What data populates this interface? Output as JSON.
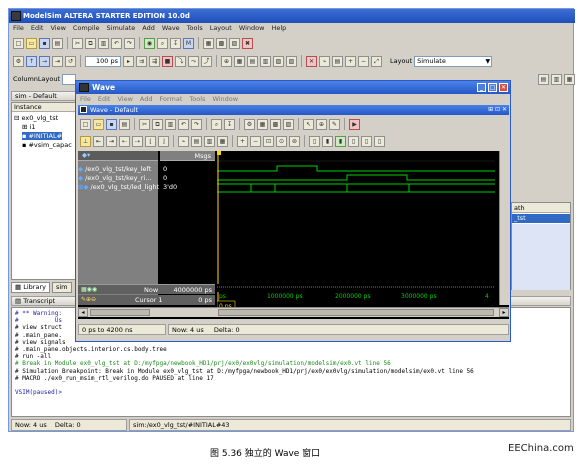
{
  "app": {
    "title": "ModelSim ALTERA STARTER EDITION 10.0d"
  },
  "main_menu": [
    "File",
    "Edit",
    "View",
    "Compile",
    "Simulate",
    "Add",
    "Wave",
    "Tools",
    "Layout",
    "Window",
    "Help"
  ],
  "toolbar": {
    "run_length": "100 ps",
    "layout_label": "Layout",
    "layout_value": "Simulate",
    "column_layout_label": "ColumnLayout"
  },
  "sim_panel": {
    "title": "sim - Default",
    "column_instance": "Instance",
    "tree": [
      "ex0_vlg_tst",
      "i1",
      "#INITIAL#",
      "#vsim_capac"
    ],
    "tabs": [
      "Library",
      "sim"
    ]
  },
  "right_panel": {
    "column": "ath",
    "row_text": "_tst"
  },
  "wave": {
    "title": "Wave",
    "menu": [
      "File",
      "Edit",
      "View",
      "Add",
      "Format",
      "Tools",
      "Window"
    ],
    "subtitle": "Wave - Default",
    "msgs_header": "Msgs",
    "signals": [
      {
        "name": "/ex0_vlg_tst/key_left",
        "value": "0"
      },
      {
        "name": "/ex0_vlg_tst/key_ri...",
        "value": "0"
      },
      {
        "name": "/ex0_vlg_tst/led_light",
        "value": "3'd0"
      }
    ],
    "now_label": "Now",
    "now_value": "4000000 ps",
    "cursor_label": "Cursor 1",
    "cursor_value": "0 ps",
    "cursor_tag": "0 ps",
    "time_axis": [
      "ps",
      "1000000 ps",
      "2000000 ps",
      "3000000 ps",
      "4"
    ],
    "status_range": "0 ps to 4200 ns",
    "status_now": "Now: 4 us",
    "status_delta": "Delta: 0"
  },
  "transcript": {
    "title": "Transcript",
    "lines": [
      {
        "text": "# ** Warning:",
        "color": "#1c1c9c"
      },
      {
        "text": "#          Us",
        "color": "#1c1c9c"
      },
      {
        "text": "# view struct",
        "color": "#000000"
      },
      {
        "text": "# .main_pane.",
        "color": "#000000"
      },
      {
        "text": "# view signals",
        "color": "#000000"
      },
      {
        "text": "# .main_pane.objects.interior.cs.body.tree",
        "color": "#000000"
      },
      {
        "text": "# run -all",
        "color": "#000000"
      },
      {
        "text": "# Break in Module ex0_vlg_tst at D:/myfpga/newbook_HD1/prj/ex0/ex0vlg/simulation/modelsim/ex0.vt line 56",
        "color": "#1c8a1c"
      },
      {
        "text": "# Simulation Breakpoint: Break in Module ex0_vlg_tst at D:/myfpga/newbook_HD1/prj/ex0/ex0vlg/simulation/modelsim/ex0.vt line 56",
        "color": "#000000"
      },
      {
        "text": "# MACRO ./ex0_run_msim_rtl_verilog.do PAUSED at line 17",
        "color": "#000000"
      },
      {
        "text": "",
        "color": "#000000"
      },
      {
        "text": "VSIM(paused)>",
        "color": "#1c1c9c"
      }
    ]
  },
  "statusbar": {
    "now": "Now: 4 us",
    "delta": "Delta: 0",
    "path": "sim:/ex0_vlg_tst/#INITIAL#43"
  },
  "caption": "图 5.36  独立的 Wave 窗口",
  "watermark": "EEChina.com",
  "colors": {
    "title_blue": "#2458c7",
    "wave_bg": "#000000",
    "signal_green": "#00d000",
    "cursor_yellow": "#ffd700",
    "signal_panel": "#808080"
  }
}
